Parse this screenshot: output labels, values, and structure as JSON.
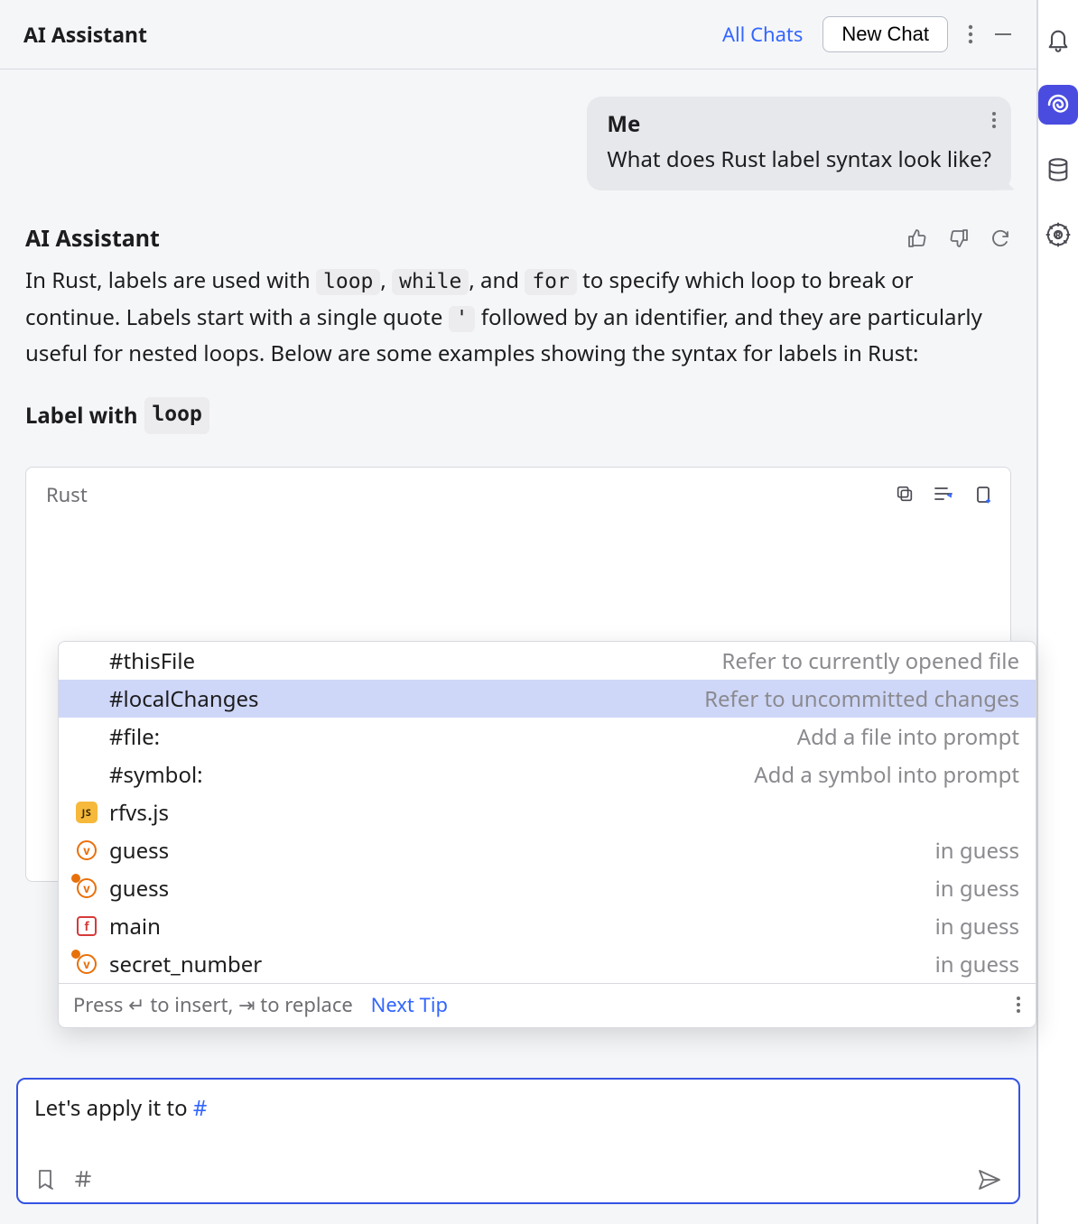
{
  "header": {
    "title": "AI Assistant",
    "all_chats": "All Chats",
    "new_chat": "New Chat"
  },
  "chat": {
    "user_sender": "Me",
    "user_message": "What does Rust label syntax look like?",
    "assistant_title": "AI Assistant",
    "assistant_para_1a": "In Rust, labels are used with ",
    "code_loop": "loop",
    "sep_comma": ", ",
    "code_while": "while",
    "sep_and": ", and ",
    "code_for": "for",
    "assistant_para_1b": " to specify which loop to break or continue. Labels start with a single quote ",
    "code_quote": "'",
    "assistant_para_1c": " followed by an identifier, and they are particularly useful for nested loops. Below are some examples showing the syntax for labels in Rust:",
    "section_title": "Label with ",
    "section_code": "loop"
  },
  "code_panel": {
    "language": "Rust"
  },
  "suggestions": {
    "items": [
      {
        "icon": "none",
        "label": "#thisFile",
        "hint": "Refer to currently opened file",
        "selected": false
      },
      {
        "icon": "none",
        "label": "#localChanges",
        "hint": "Refer to uncommitted changes",
        "selected": true
      },
      {
        "icon": "none",
        "label": "#file:",
        "hint": "Add a file into prompt",
        "selected": false
      },
      {
        "icon": "none",
        "label": "#symbol:",
        "hint": "Add a symbol into prompt",
        "selected": false
      },
      {
        "icon": "js",
        "label": "rfvs.js",
        "hint": "",
        "selected": false
      },
      {
        "icon": "v",
        "label": "guess",
        "hint": "in guess",
        "selected": false
      },
      {
        "icon": "vgear",
        "label": "guess",
        "hint": "in guess",
        "selected": false
      },
      {
        "icon": "f",
        "label": "main",
        "hint": "in guess",
        "selected": false
      },
      {
        "icon": "vgear",
        "label": "secret_number",
        "hint": "in guess",
        "selected": false
      }
    ],
    "footer_text": "Press ↵ to insert, ⇥ to replace",
    "next_tip": "Next Tip"
  },
  "input": {
    "text_prefix": "Let's apply it to ",
    "hash": "#"
  },
  "icons": {
    "more": "more-vertical-icon",
    "minimize": "minimize-icon",
    "thumbs_up": "thumbs-up-icon",
    "thumbs_down": "thumbs-down-icon",
    "regenerate": "regenerate-icon",
    "copy": "copy-icon",
    "wrap": "wrap-lines-icon",
    "insert": "insert-snippet-icon",
    "bookmark": "bookmark-icon",
    "hash": "hash-icon",
    "send": "send-icon",
    "bell": "bell-icon",
    "spiral": "ai-assistant-icon",
    "db": "database-icon",
    "rust": "rust-icon"
  }
}
